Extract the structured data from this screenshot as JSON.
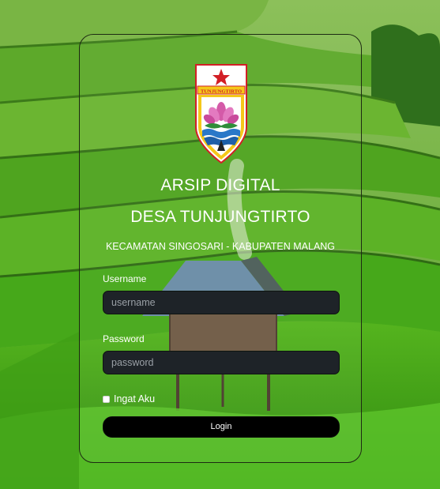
{
  "app": {
    "title_line1": "ARSIP DIGITAL",
    "title_line2": "DESA TUNJUNGTIRTO",
    "subtitle": "KECAMATAN SINGOSARI - KABUPATEN MALANG"
  },
  "logo": {
    "banner_text": "TUNJUNGTIRTO",
    "icon": "village-emblem-icon"
  },
  "form": {
    "username_label": "Username",
    "username_placeholder": "username",
    "username_value": "",
    "password_label": "Password",
    "password_placeholder": "password",
    "password_value": "",
    "remember_label": "Ingat Aku",
    "remember_checked": false,
    "login_label": "Login"
  },
  "colors": {
    "card_border": "#1d2a12",
    "input_bg": "#1e2328",
    "button_bg": "#000000",
    "emblem_red": "#d21f26",
    "emblem_yellow": "#f5c81a"
  }
}
